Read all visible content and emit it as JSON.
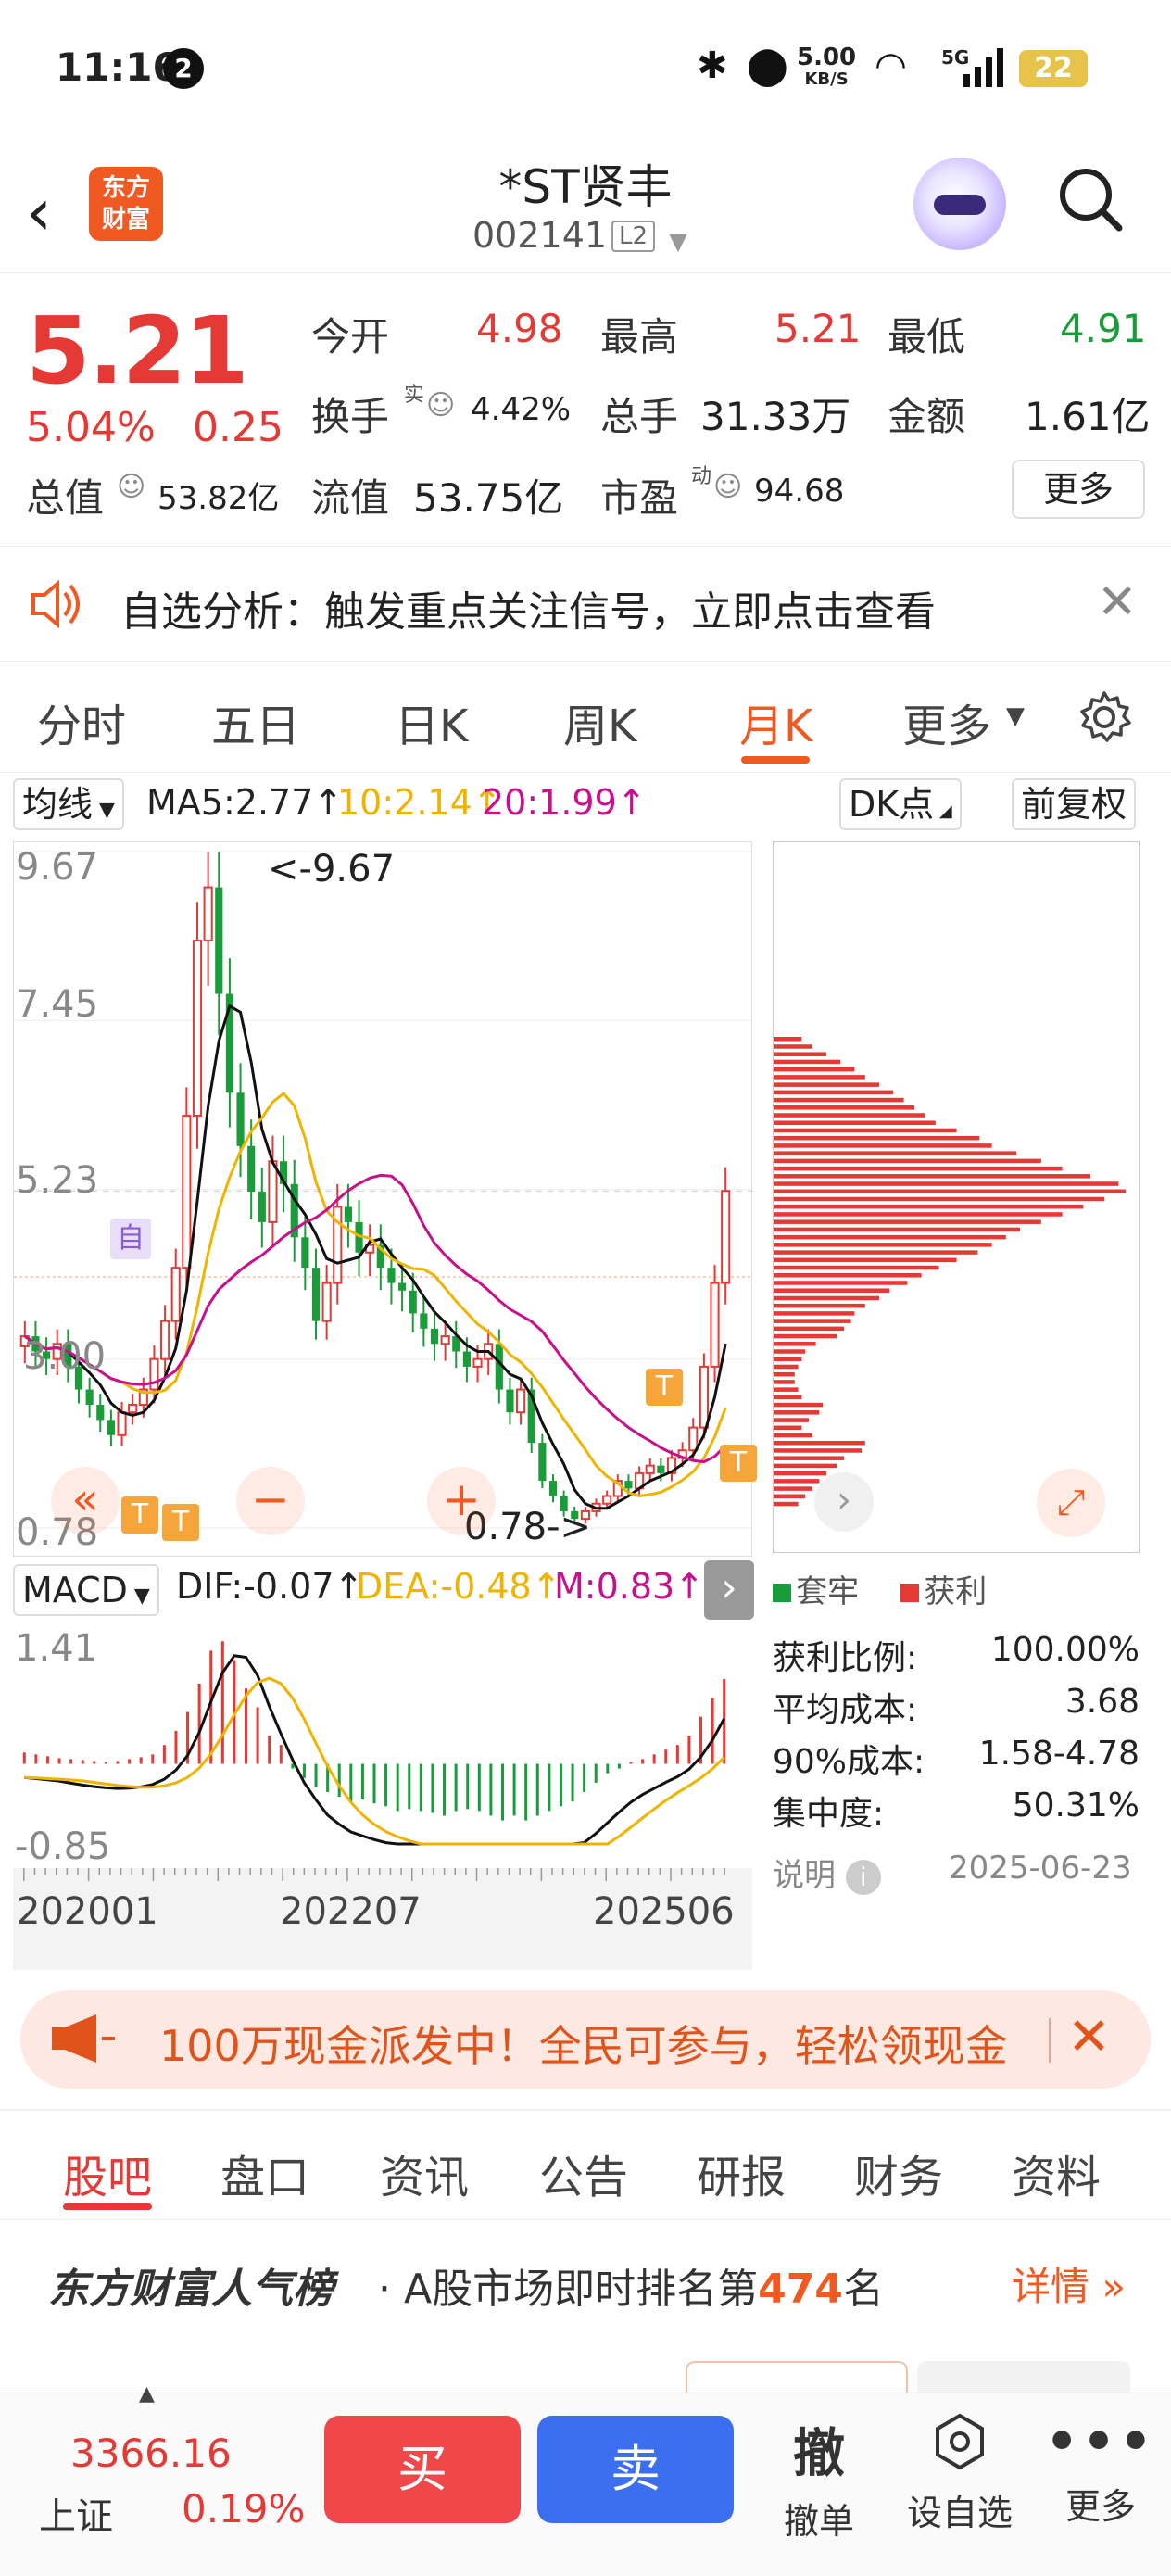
{
  "status_bar": {
    "time": "11:16",
    "notification_count": "2",
    "network_speed_value": "5.00",
    "network_speed_unit": "KB/S",
    "signal_label": "5G",
    "battery": "22"
  },
  "header": {
    "logo_text_line1": "东方",
    "logo_text_line2": "财富",
    "title": "*ST贤丰",
    "code": "002141",
    "level_badge": "L2"
  },
  "quote": {
    "price": "5.21",
    "change_pct": "5.04%",
    "change_amt": "0.25",
    "open_label": "今开",
    "open_value": "4.98",
    "high_label": "最高",
    "high_value": "5.21",
    "low_label": "最低",
    "low_value": "4.91",
    "turnover_label": "换手",
    "turnover_sup": "实",
    "turnover_value": "4.42%",
    "volume_label": "总手",
    "volume_value": "31.33万",
    "amount_label": "金额",
    "amount_value": "1.61亿",
    "mktcap_label": "总值",
    "mktcap_value": "53.82亿",
    "float_label": "流值",
    "float_value": "53.75亿",
    "pe_label": "市盈",
    "pe_sup": "动",
    "pe_value": "94.68",
    "more_label": "更多"
  },
  "promo": {
    "text": "自选分析：触发重点关注信号，立即点击查看"
  },
  "tabs": {
    "items": [
      "分时",
      "五日",
      "日K",
      "周K",
      "月K",
      "更多"
    ],
    "active": "月K"
  },
  "chart_toolbar": {
    "indicator_label": "均线",
    "ma5": "MA5:2.77↑",
    "ma10": "10:2.14↑",
    "ma20": "20:1.99↑",
    "dk_label": "DK点",
    "adjust_label": "前复权"
  },
  "kline": {
    "y_labels": [
      "9.67",
      "7.45",
      "5.23",
      "3.00",
      "0.78"
    ],
    "max_marker": "<-9.67",
    "min_marker": "0.78->",
    "self_marker": "自",
    "t_marker": "T"
  },
  "macd": {
    "label": "MACD",
    "dif": "DIF:-0.07↑",
    "dea": "DEA:-0.48↑",
    "m": "M:0.83↑",
    "y_top": "1.41",
    "y_bottom": "-0.85"
  },
  "x_axis": [
    "202001",
    "202207",
    "202506"
  ],
  "chip": {
    "legend_trapped": "套牢",
    "legend_profit": "获利",
    "rows": [
      {
        "label": "获利比例:",
        "value": "100.00%"
      },
      {
        "label": "平均成本:",
        "value": "3.68"
      },
      {
        "label": "90%成本:",
        "value": "1.58-4.78"
      },
      {
        "label": "集中度:",
        "value": "50.31%"
      }
    ],
    "note_label": "说明",
    "date": "2025-06-23"
  },
  "banner": {
    "text": "100万现金派发中！全民可参与，轻松领现金"
  },
  "subtabs": {
    "items": [
      "股吧",
      "盘口",
      "资讯",
      "公告",
      "研报",
      "财务",
      "资料"
    ],
    "active": "股吧"
  },
  "rank": {
    "title": "东方财富人气榜",
    "prefix": "· A股市场即时排名第",
    "number": "474",
    "suffix": "名",
    "detail": "详情"
  },
  "footer": {
    "index_value": "3366.16",
    "index_name": "上证",
    "index_pct": "0.19%",
    "buy": "买",
    "sell": "卖",
    "cancel_icon": "撤",
    "cancel": "撤单",
    "watch": "设自选",
    "more": "更多"
  },
  "colors": {
    "up": "#e53935",
    "down": "#1a9c3a",
    "accent": "#f05a22",
    "ma5": "#111111",
    "ma10": "#f0b400",
    "ma20": "#c8108c"
  }
}
